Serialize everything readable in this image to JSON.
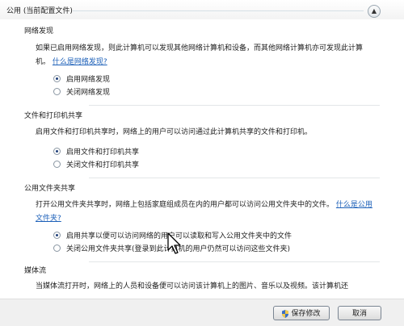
{
  "profile": {
    "title": "公用 (当前配置文件)",
    "collapse_icon": "chevron-up-icon"
  },
  "sections": {
    "discovery": {
      "title": "网络发现",
      "desc_text": "如果已启用网络发现，则此计算机可以发现其他网络计算机和设备，而其他网络计算机亦可发现此计算机。",
      "link": "什么是网络发现?",
      "options": [
        "启用网络发现",
        "关闭网络发现"
      ]
    },
    "file_print": {
      "title": "文件和打印机共享",
      "desc_text": "启用文件和打印机共享时，网络上的用户可以访问通过此计算机共享的文件和打印机。",
      "options": [
        "启用文件和打印机共享",
        "关闭文件和打印机共享"
      ]
    },
    "public_folder": {
      "title": "公用文件夹共享",
      "desc_text": "打开公用文件夹共享时，网络上包括家庭组成员在内的用户都可以访问公用文件夹中的文件。",
      "link": "什么是公用文件夹?",
      "options": [
        "启用共享以便可以访问网络的用户可以读取和写入公用文件夹中的文件",
        "关闭公用文件夹共享(登录到此计算机的用户仍然可以访问这些文件夹)"
      ]
    },
    "media": {
      "title": "媒体流",
      "desc_text": "当媒体流打开时，网络上的人员和设备便可以访问该计算机上的图片、音乐以及视频。该计算机还"
    }
  },
  "buttons": {
    "save": "保存修改",
    "cancel": "取消"
  }
}
